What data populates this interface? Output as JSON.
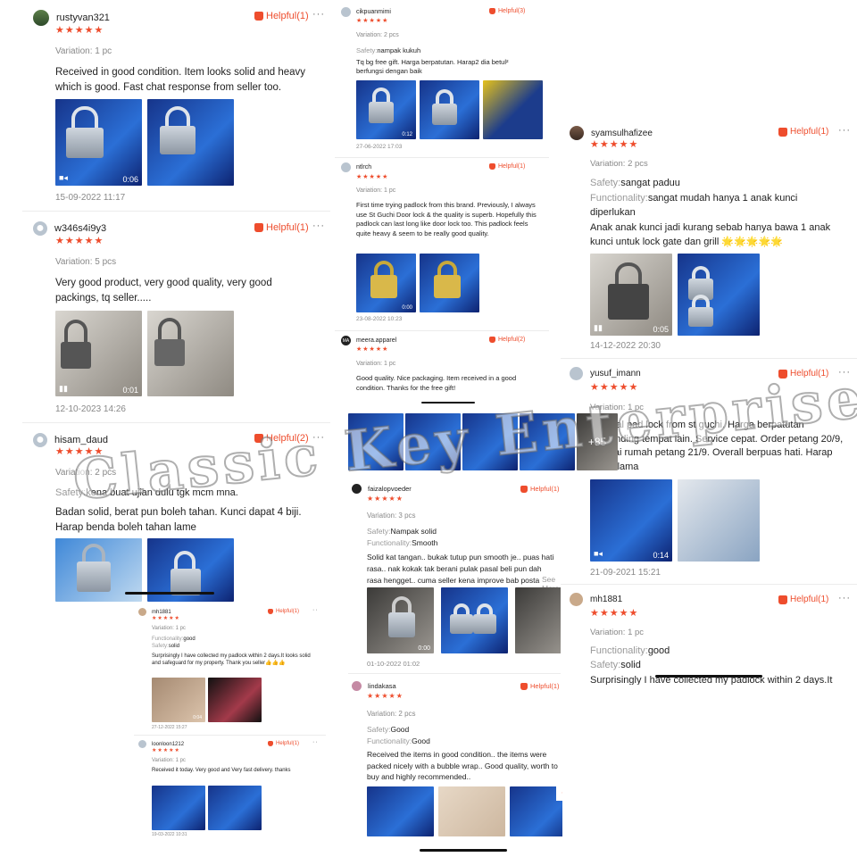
{
  "watermark": "Classic Key Enterprise",
  "colors": {
    "accent": "#ee4d2d"
  },
  "reviews": [
    {
      "user": "rustyvan321",
      "helpful": "Helpful(1)",
      "stars": "★★★★★",
      "variation": "Variation: 1 pc",
      "text": "Received in good condition. Item looks solid and heavy which is good. Fast chat response from seller too.",
      "dur": "0:06",
      "date": "15-09-2022 11:17"
    },
    {
      "user": "w346s4i9y3",
      "helpful": "Helpful(1)",
      "stars": "★★★★★",
      "variation": "Variation: 5 pcs",
      "text": "Very good product, very good quality, very good packings, tq seller.....",
      "dur": "0:01",
      "date": "12-10-2023 14:26"
    },
    {
      "user": "hisam_daud",
      "helpful": "Helpful(2)",
      "stars": "★★★★★",
      "variation": "Variation: 2 pcs",
      "safety_label": "Safety:",
      "safety": "kena buat ujian dulu tgk mcm mna.",
      "text": "Badan solid, berat pun boleh tahan. Kunci dapat 4 biji. Harap benda boleh tahan lame"
    },
    {
      "user": "mh1881",
      "helpful": "Helpful(1)",
      "stars": "★★★★★",
      "variation": "Variation: 1 pc",
      "func_label": "Functionality:",
      "func": "good",
      "safety_label": "Safety:",
      "safety": "solid",
      "text": "Surprisingly I have collected my padlock within 2 days.It looks solid and safeguard for my property. Thank you seller👍👍👍",
      "dur": "0:04",
      "date": "27-12-2022 15:27"
    },
    {
      "user": "loonloon1212",
      "helpful": "Helpful(1)",
      "stars": "★★★★★",
      "variation": "Variation: 1 pc",
      "text": "Received it today. Very good and Very fast delivery. thanks",
      "date": "19-03-2022 10:31"
    },
    {
      "user": "cikpuanmimi",
      "helpful": "Helpful(3)",
      "stars": "★★★★★",
      "variation": "Variation: 2 pcs",
      "safety_label": "Safety:",
      "safety": "nampak kukuh",
      "text": "Tq bg free gift.  Harga berpatutan. Harap2 dia betul² berfungsi dengan baik",
      "dur": "0:12",
      "date": "27-06-2022 17:03"
    },
    {
      "user": "ntlrch",
      "helpful": "Helpful(1)",
      "stars": "★★★★★",
      "variation": "Variation: 1 pc",
      "text": "First time trying padlock from this brand. Previously, I always use St Guchi Door lock & the quality is superb. Hopefully this padlock can last long like door lock too. This padlock feels quite heavy & seem to be really good quality.",
      "dur": "0:00",
      "date": "23-08-2022 10:23"
    },
    {
      "user": "meera.apparel",
      "helpful": "Helpful(2)",
      "stars": "★★★★★",
      "variation": "Variation: 1 pc",
      "text": "Good quality. Nice packaging. Item received in a good condition. Thanks for the free gift!",
      "more": "+85"
    },
    {
      "user": "faizalopvoeder",
      "helpful": "Helpful(1)",
      "stars": "★★★★★",
      "variation": "Variation: 3 pcs",
      "safety_label": "Safety:",
      "safety": "Nampak solid",
      "func_label": "Functionality:",
      "func": "Smooth",
      "text": "Solid kat tangan.. bukak tutup pun smooth je.. puas hati rasa.. nak kokak tak berani pulak pasal beli pun dah rasa hengget.. cuma seller kena improve bab posta",
      "see_more": "See More",
      "dur": "0:00",
      "date": "01-10-2022 01:02"
    },
    {
      "user": "lindakasa",
      "helpful": "Helpful(1)",
      "stars": "★★★★★",
      "variation": "Variation: 2 pcs",
      "safety_label": "Safety:",
      "safety": "Good",
      "func_label": "Functionality:",
      "func": "Good",
      "text": "Received the items in good condition.. the items were packed nicely with a bubble wrap.. Good quality, worth to buy and highly recommended.."
    },
    {
      "user": "syamsulhafizee",
      "helpful": "Helpful(1)",
      "stars": "★★★★★",
      "variation": "Variation: 2 pcs",
      "safety_label": "Safety:",
      "safety": "sangat paduu",
      "func_label": "Functionality:",
      "func": "sangat mudah hanya 1 anak kunci diperlukan",
      "text": "Anak anak kunci jadi kurang sebab hanya bawa 1 anak kunci untuk lock gate dan grill 🌟🌟🌟🌟🌟",
      "dur": "0:05",
      "date": "14-12-2022 20:30"
    },
    {
      "user": "yusuf_imann",
      "helpful": "Helpful(1)",
      "stars": "★★★★★",
      "variation": "Variation: 1 pc",
      "text": "Original pad lock from st guchi. Harga berpatutan berbanding tempat lain. Service cepat. Order petang 20/9, sampai rumah petang 21/9. Overall berpuas hati. Harap tahan lama",
      "dur": "0:14",
      "date": "21-09-2021 15:21"
    },
    {
      "user": "mh1881",
      "helpful": "Helpful(1)",
      "stars": "★★★★★",
      "variation": "Variation: 1 pc",
      "func_label": "Functionality:",
      "func": "good",
      "safety_label": "Safety:",
      "safety": "solid",
      "text": "Surprisingly I have collected my padlock within 2 days.It"
    }
  ]
}
